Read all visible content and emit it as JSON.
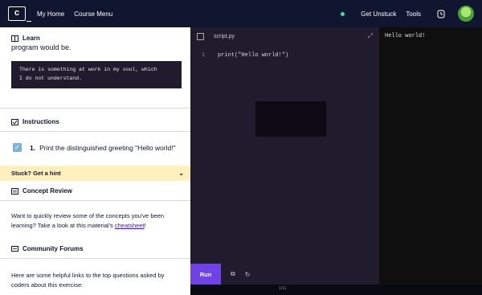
{
  "topbar": {
    "logo_text": "c",
    "nav": [
      "My Home",
      "Course Menu"
    ],
    "get_unstuck": "Get Unstuck",
    "tools": "Tools",
    "status_color": "#3ee0a0"
  },
  "learn": {
    "heading": "Learn",
    "cut_text": "program would be.",
    "quote_lines": [
      "There is something at work in my soul, which",
      "I do not understand."
    ]
  },
  "instructions": {
    "heading": "Instructions",
    "task_number": "1.",
    "task_text": "Print the distinguished greeting \"Hello world!\"",
    "hint_label": "Stuck? Get a hint"
  },
  "concept_review": {
    "heading": "Concept Review",
    "text": "Want to quickly review some of the concepts you've been learning? Take a look at this material's ",
    "link": "cheatsheet",
    "text_end": "!"
  },
  "community": {
    "heading": "Community Forums",
    "text": "Here are some helpful links to the top questions asked by coders about this exercise:"
  },
  "editor": {
    "filename": "script.py",
    "line_number": "1",
    "code": "print(\"Hello world!\")",
    "run_label": "Run"
  },
  "output": {
    "text": "Hello world!"
  },
  "footer": {
    "progress_text": "1/11"
  },
  "colors": {
    "accent": "#6f42e8",
    "hint_bg": "#fff0bd",
    "checkbox": "#7eb3d8"
  }
}
